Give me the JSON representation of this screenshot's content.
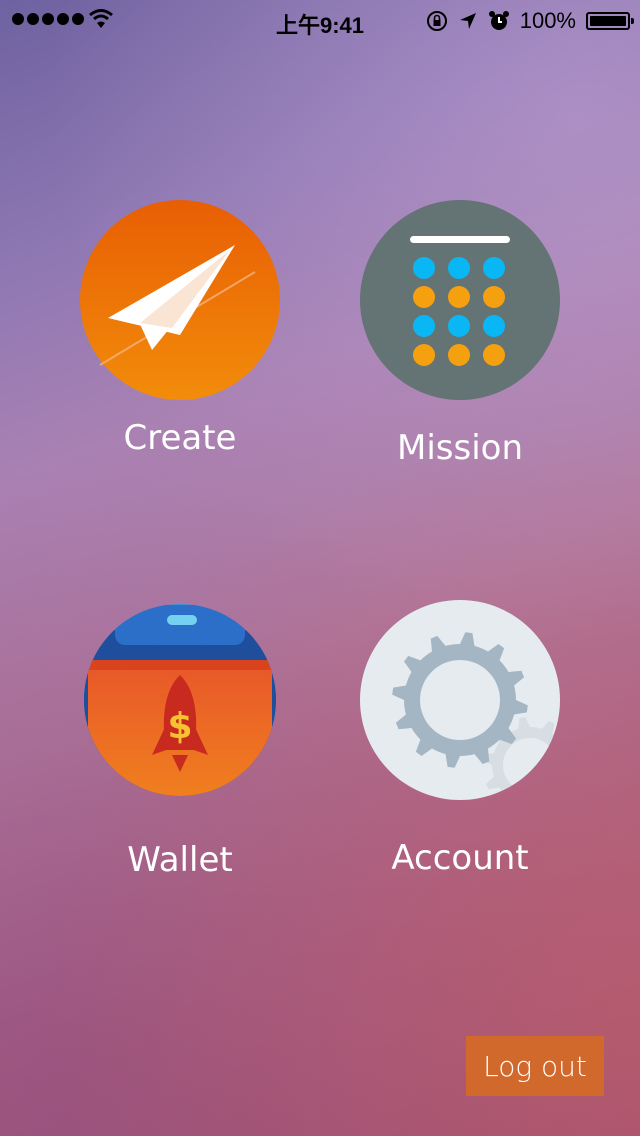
{
  "status_bar": {
    "time": "上午9:41",
    "battery_percent": "100%",
    "signal_bars": 5,
    "icons": [
      "signal-icon",
      "wifi-icon",
      "rotation-lock-icon",
      "location-icon",
      "alarm-icon",
      "battery-icon"
    ]
  },
  "menu": {
    "create_label": "Create",
    "mission_label": "Mission",
    "wallet_label": "Wallet",
    "account_label": "Account",
    "icons": [
      "paper-plane-icon",
      "dot-grid-icon",
      "wallet-rocket-icon",
      "gear-icon"
    ]
  },
  "logout_label": "Log out",
  "colors": {
    "create_icon": "#ee7a0a",
    "mission_icon": "#647374",
    "dot_blue": "#0ab7f5",
    "dot_orange": "#f5a00f",
    "account_icon": "#e6ebef",
    "gear": "#a4b6c4",
    "logout_button": "#d2692c"
  }
}
